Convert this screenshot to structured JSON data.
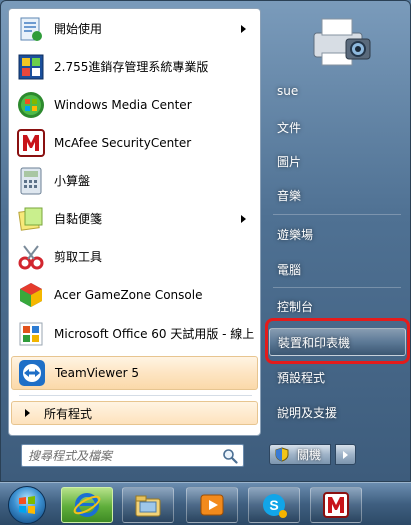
{
  "programs": [
    {
      "label": "開始使用",
      "icon": "getting-started-icon",
      "has_submenu": true
    },
    {
      "label": "2.755進銷存管理系統專業版",
      "icon": "inventory-app-icon",
      "has_submenu": false
    },
    {
      "label": "Windows Media Center",
      "icon": "windows-media-center-icon",
      "has_submenu": false
    },
    {
      "label": "McAfee SecurityCenter",
      "icon": "mcafee-icon",
      "has_submenu": false
    },
    {
      "label": "小算盤",
      "icon": "calculator-icon",
      "has_submenu": false
    },
    {
      "label": "自黏便箋",
      "icon": "sticky-notes-icon",
      "has_submenu": true
    },
    {
      "label": "剪取工具",
      "icon": "snipping-tool-icon",
      "has_submenu": false
    },
    {
      "label": "Acer GameZone Console",
      "icon": "gamezone-icon",
      "has_submenu": false
    },
    {
      "label": "Microsoft Office 60 天試用版 - 線上",
      "icon": "office-icon",
      "has_submenu": false
    },
    {
      "label": "TeamViewer 5",
      "icon": "teamviewer-icon",
      "has_submenu": false,
      "highlighted": true
    }
  ],
  "all_programs_label": "所有程式",
  "search": {
    "placeholder": "搜尋程式及檔案"
  },
  "right_items": [
    {
      "label": "sue"
    },
    {
      "label": "文件"
    },
    {
      "label": "圖片"
    },
    {
      "label": "音樂"
    },
    {
      "label": "遊樂場"
    },
    {
      "label": "電腦"
    },
    {
      "label": "控制台"
    },
    {
      "label": "裝置和印表機",
      "selected": true
    },
    {
      "label": "預設程式"
    },
    {
      "label": "說明及支援"
    }
  ],
  "shutdown_label": "關機",
  "colors": {
    "highlight_red": "#e41b1b",
    "hover_orange": "#fbd9a9",
    "glass_blue": "#4f7193"
  },
  "taskbar_apps": [
    "internet-explorer-icon",
    "windows-explorer-icon",
    "media-player-icon",
    "skype-icon",
    "mcafee-icon"
  ]
}
